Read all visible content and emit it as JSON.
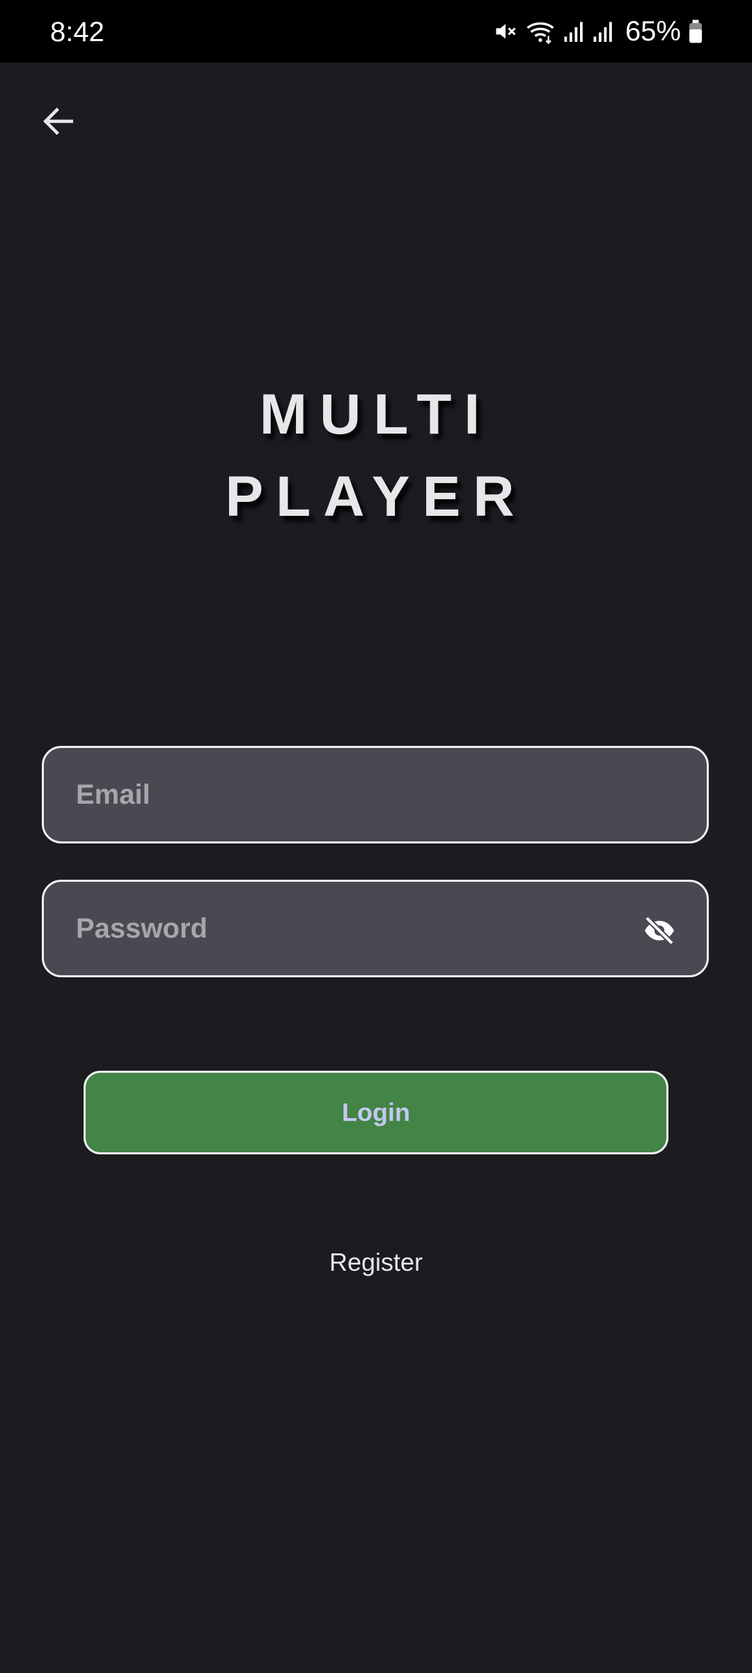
{
  "status_bar": {
    "time": "8:42",
    "battery": "65%",
    "icons": [
      "mute-icon",
      "wifi-icon",
      "signal-icon",
      "signal-icon",
      "battery-icon"
    ]
  },
  "header": {
    "back_icon": "arrow-left-icon"
  },
  "title": {
    "line1": "MULTI",
    "line2": "PLAYER"
  },
  "form": {
    "email": {
      "value": "",
      "placeholder": "Email"
    },
    "password": {
      "value": "",
      "placeholder": "Password",
      "toggle_icon": "eye-off-icon"
    },
    "login_label": "Login",
    "register_label": "Register"
  },
  "colors": {
    "background": "#1c1b20",
    "status_bar": "#000000",
    "field_fill": "#4b4852",
    "field_border": "#f2f0f4",
    "login_button": "#438447",
    "login_text": "#c5c8f2",
    "title_text": "#e9e6ea"
  }
}
